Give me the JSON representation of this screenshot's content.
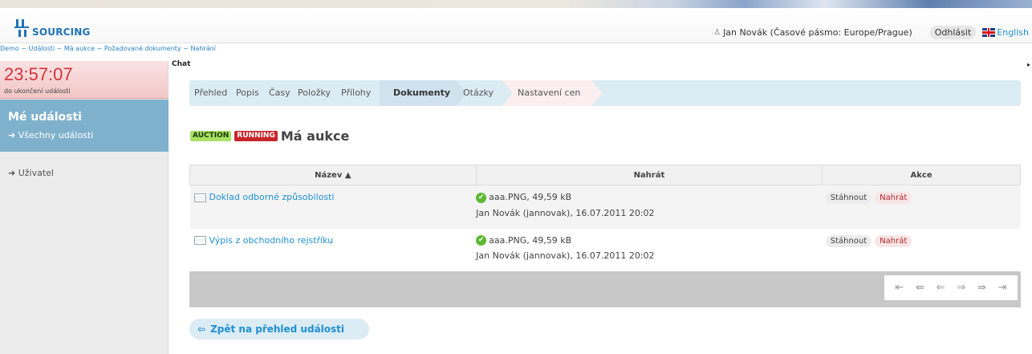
{
  "header": {
    "logo_text": "SOURCING",
    "user_name": "Jan Novák (Časové pásmo: Europe/Prague)",
    "logout_label": "Odhlásit",
    "language_label": "English"
  },
  "breadcrumb": "Demo ~ Události ~ Má aukce ~ Požadované dokumenty ~ Nahrání",
  "sidebar": {
    "timer": "23:57:07",
    "timer_label": "do ukončení události",
    "my_events_title": "Mé události",
    "all_events_link": "Všechny události",
    "users_link": "Uživatel"
  },
  "chat_label": "Chat",
  "tabs": [
    "Přehled",
    "Popis",
    "Časy",
    "Položky",
    "Přílohy",
    "Dokumenty",
    "Otázky",
    "Nastavení cen"
  ],
  "active_tab": "Dokumenty",
  "auction": {
    "badge_type": "AUCTION",
    "badge_status": "RUNNING",
    "title": "Má aukce"
  },
  "table": {
    "headers": [
      "Název ▲",
      "Nahrát",
      "Akce"
    ],
    "rows": [
      {
        "name": "Doklad odborné způsobilosti",
        "file": "aaa.PNG, 49,59 kB",
        "uploader": "Jan Novák (jannovak), 16.07.2011 20:02",
        "download_label": "Stáhnout",
        "upload_label": "Nahrát"
      },
      {
        "name": "Výpis z obchodního rejstříku",
        "file": "aaa.PNG, 49,59 kB",
        "uploader": "Jan Novák (jannovak), 16.07.2011 20:02",
        "download_label": "Stáhnout",
        "upload_label": "Nahrát"
      }
    ]
  },
  "pager_icons": [
    "first-page-icon",
    "prev-fast-icon",
    "prev-page-icon",
    "next-page-icon",
    "next-fast-icon",
    "last-page-icon"
  ],
  "back_label": "Zpět na přehled události",
  "colors": {
    "accent": "#1f8fd2",
    "sidebar_active": "#7fb1cd",
    "timer_red": "#d4323c",
    "badge_green": "#a8e064",
    "badge_red": "#c8262d"
  }
}
